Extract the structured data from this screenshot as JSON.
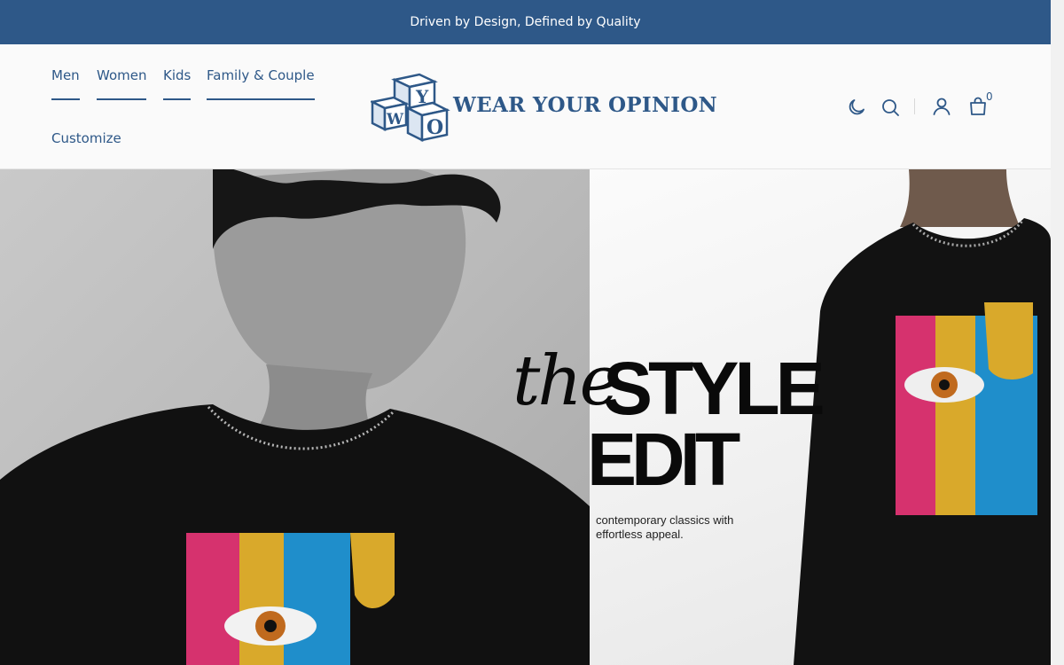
{
  "announcement": {
    "text": "Driven by Design, Defined by Quality"
  },
  "nav": {
    "items": [
      {
        "label": "Men"
      },
      {
        "label": "Women"
      },
      {
        "label": "Kids"
      },
      {
        "label": "Family & Couple"
      },
      {
        "label": "Customize"
      }
    ]
  },
  "logo": {
    "text": "WEAR YOUR OPINION",
    "blocks": [
      "Y",
      "W",
      "O"
    ]
  },
  "header_icons": {
    "theme": "moon-icon",
    "search": "search-icon",
    "account": "user-icon",
    "cart": "shopping-bag-icon",
    "cart_count": "0"
  },
  "hero": {
    "headline_the": "the",
    "headline_style": "STYLE",
    "headline_edit": "EDIT",
    "tagline": "contemporary classics with effortless appeal."
  },
  "colors": {
    "brand": "#2e5888",
    "announcement_bg": "#2e5888",
    "header_bg": "#fafafa",
    "tshirt_pink": "#d6326e",
    "tshirt_blue": "#1f8ecb",
    "tshirt_gold": "#d9a92b"
  }
}
